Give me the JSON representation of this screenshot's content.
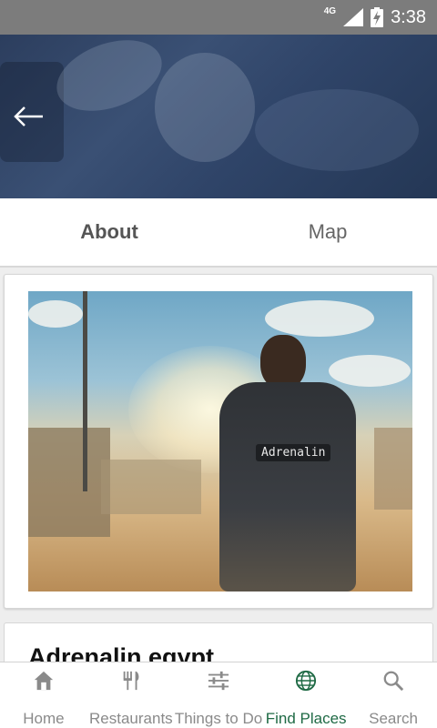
{
  "status_bar": {
    "network": "4G",
    "time": "3:38"
  },
  "tabs": [
    {
      "label": "About",
      "active": true
    },
    {
      "label": "Map",
      "active": false
    }
  ],
  "photo": {
    "vest_text": "Adrenalin"
  },
  "place": {
    "title": "Adrenalin egypt"
  },
  "bottom_nav": [
    {
      "label": "Home",
      "icon": "home-icon",
      "active": false
    },
    {
      "label": "Restaurants",
      "icon": "fork-knife-icon",
      "active": false
    },
    {
      "label": "Things to Do",
      "icon": "sliders-icon",
      "active": false
    },
    {
      "label": "Find Places",
      "icon": "globe-icon",
      "active": true
    },
    {
      "label": "Search",
      "icon": "search-icon",
      "active": false
    }
  ],
  "colors": {
    "active_nav": "#1f6a45",
    "inactive_nav": "#8a8a8a",
    "status_bar": "#7c7c7c",
    "header_overlay": "#2c3e5e"
  }
}
